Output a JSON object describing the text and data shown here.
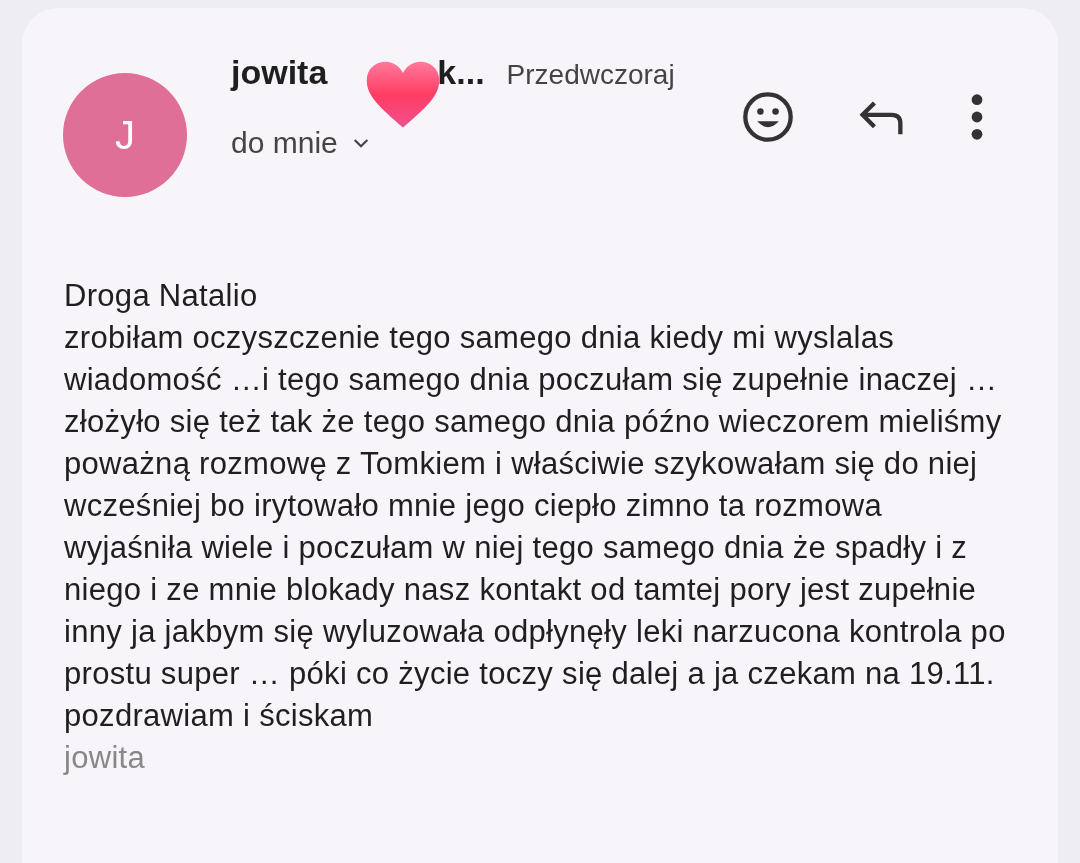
{
  "message": {
    "sender_avatar": "J",
    "sender_name_start": "jowita",
    "sender_name_end": "k...",
    "date": "Przedwczoraj",
    "recipient": "do mnie",
    "greeting": "Droga Natalio",
    "body": "zrobiłam oczyszczenie tego samego dnia kiedy mi wyslalas wiadomość …i tego samego dnia poczułam się zupełnie inaczej …złożyło się też tak że tego samego dnia późno wieczorem mieliśmy poważną rozmowę z Tomkiem i właściwie szykowałam się do niej wcześniej bo irytowało mnie jego ciepło zimno ta rozmowa wyjaśniła wiele i poczułam w niej tego samego dnia że spadły i z niego i ze mnie blokady nasz kontakt od tamtej pory jest zupełnie inny ja jakbym się wyluzowała odpłynęły leki narzucona kontrola po prostu super … póki co życie toczy się dalej a ja czekam na 19.11.",
    "closing": "pozdrawiam i ściskam",
    "signature": "jowita"
  }
}
